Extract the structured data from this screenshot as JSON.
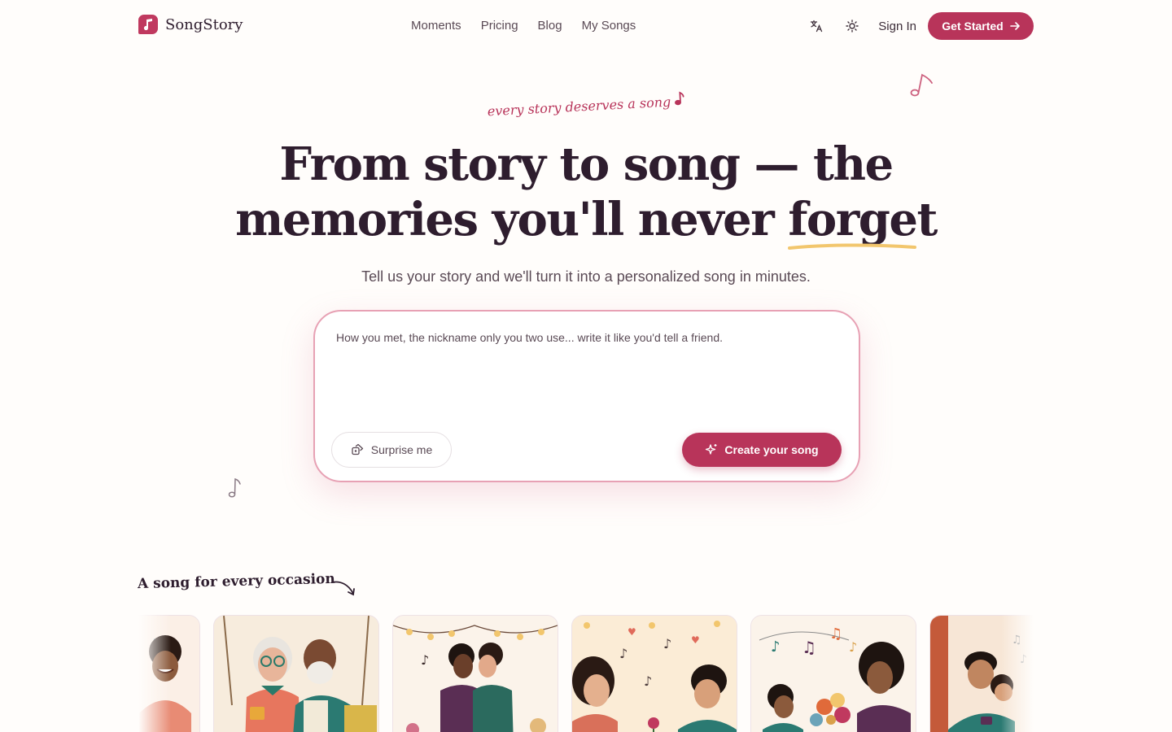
{
  "brand": {
    "name": "SongStory"
  },
  "nav": {
    "links": [
      "Moments",
      "Pricing",
      "Blog",
      "My Songs"
    ],
    "sign_in": "Sign In",
    "get_started": "Get Started"
  },
  "hero": {
    "tagline": "every story deserves a song",
    "headline_line1": "From story to song — the",
    "headline_line2_pre": "memories you'll never",
    "headline_highlight": "forget",
    "subtitle": "Tell us your story and we'll turn it into a personalized song in minutes."
  },
  "story_form": {
    "placeholder": "How you met, the nickname only you two use... write it like you'd tell a friend.",
    "surprise_label": "Surprise me",
    "create_label": "Create your song"
  },
  "occasions": {
    "heading": "A song for every occasion",
    "cards": [
      {
        "name": "woman-smiling"
      },
      {
        "name": "elderly-couple"
      },
      {
        "name": "wedding-couple"
      },
      {
        "name": "young-couple"
      },
      {
        "name": "mother-and-child-flowers"
      },
      {
        "name": "father-and-child-music"
      }
    ]
  },
  "colors": {
    "accent": "#b8345a",
    "ink": "#2e1d2e",
    "muted": "#5a4a55",
    "highlight": "#f2c66d"
  }
}
